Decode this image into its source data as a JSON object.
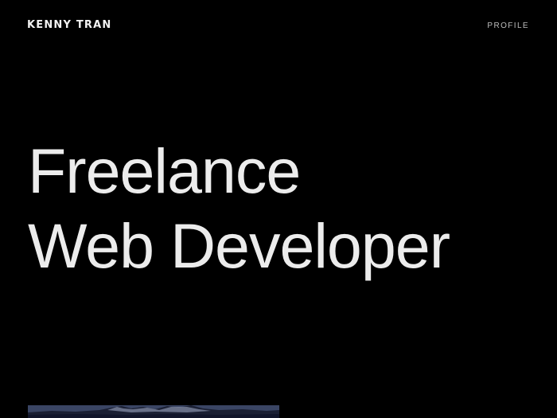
{
  "header": {
    "brand": "KENNY TRAN",
    "nav_profile": "PROFILE"
  },
  "hero": {
    "line1": "Freelance",
    "line2": "Web Developer"
  },
  "colors": {
    "background": "#000000",
    "text": "#ececec",
    "nav_text": "#bdbdbd"
  },
  "media": {
    "icon": "mountain-landscape-image"
  }
}
